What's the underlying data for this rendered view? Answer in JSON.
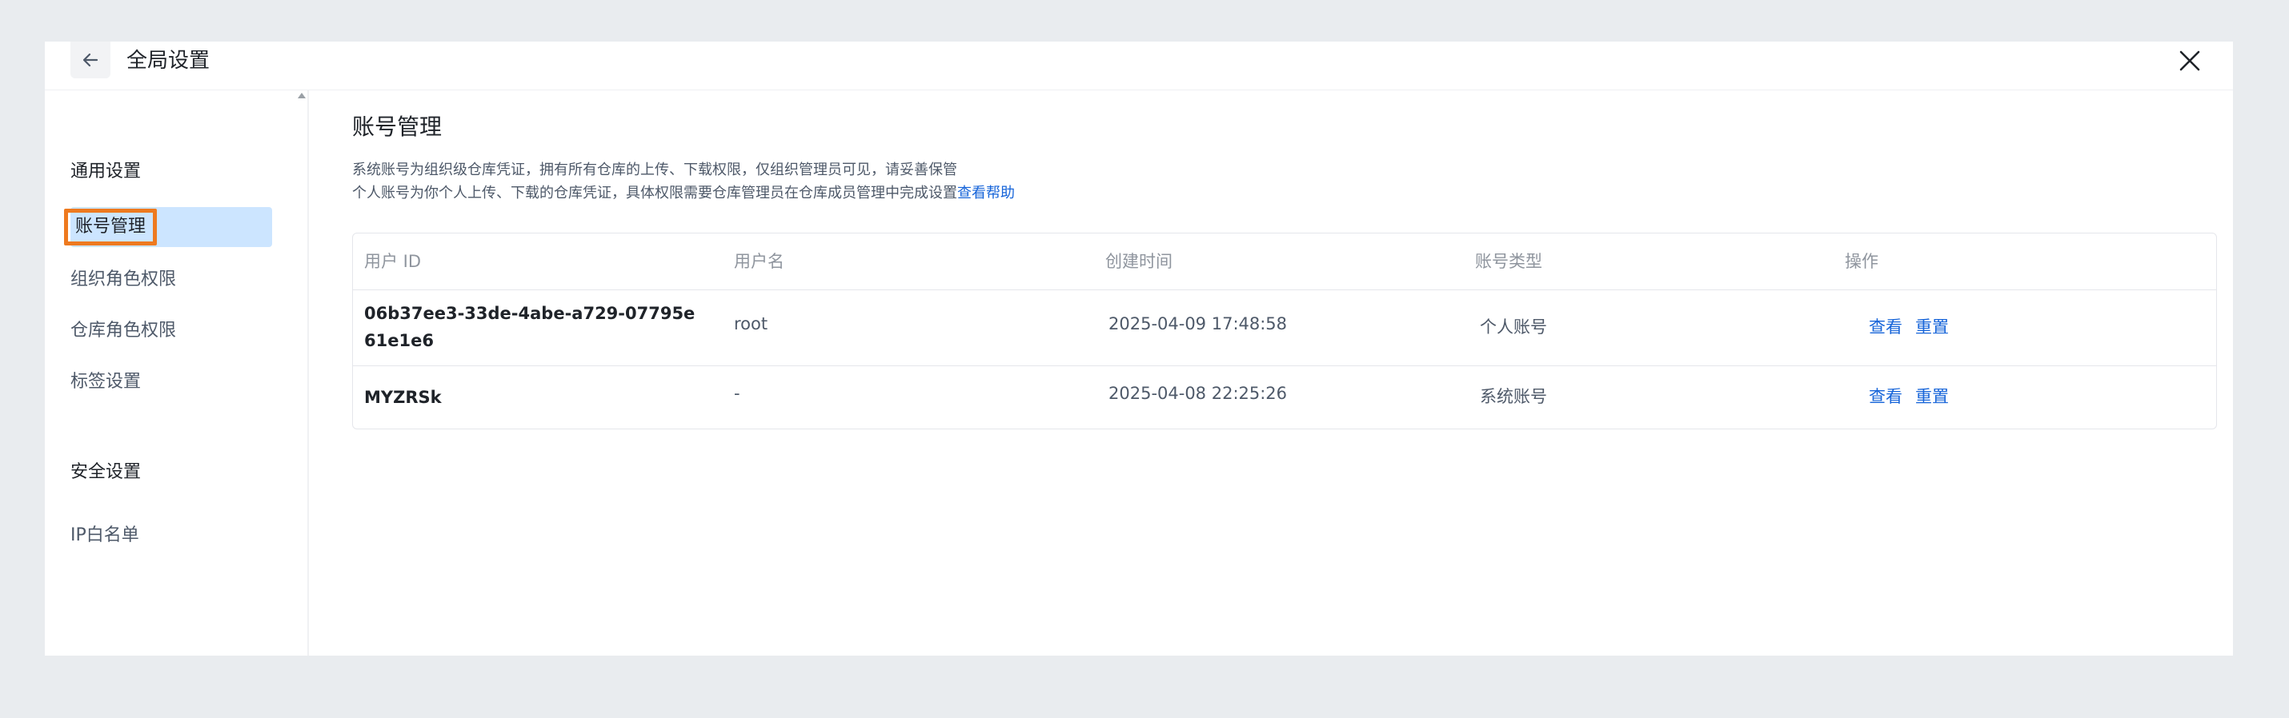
{
  "dialog": {
    "title": "全局设置"
  },
  "sidebar": {
    "groups": [
      {
        "label": "通用设置",
        "items": [
          {
            "label": "账号管理",
            "active": true
          },
          {
            "label": "组织角色权限",
            "active": false
          },
          {
            "label": "仓库角色权限",
            "active": false
          },
          {
            "label": "标签设置",
            "active": false
          }
        ]
      },
      {
        "label": "安全设置",
        "items": [
          {
            "label": "IP白名单",
            "active": false
          }
        ]
      }
    ]
  },
  "main": {
    "title": "账号管理",
    "desc_line1": "系统账号为组织级仓库凭证，拥有所有仓库的上传、下载权限，仅组织管理员可见，请妥善保管",
    "desc_line2": "个人账号为你个人上传、下载的仓库凭证，具体权限需要仓库管理员在仓库成员管理中完成设置",
    "help_link": "查看帮助"
  },
  "table": {
    "headers": [
      "用户 ID",
      "用户名",
      "创建时间",
      "账号类型",
      "操作"
    ],
    "rows": [
      {
        "id": "06b37ee3-33de-4abe-a729-07795e61e1e6",
        "username": "root",
        "created": "2025-04-09 17:48:58",
        "type": "个人账号",
        "view": "查看",
        "reset": "重置"
      },
      {
        "id": "MYZRSk",
        "username": "-",
        "created": "2025-04-08 22:25:26",
        "type": "系统账号",
        "view": "查看",
        "reset": "重置"
      }
    ]
  },
  "icons": {
    "back": "arrow-left-icon",
    "close": "close-icon",
    "scroll_up": "caret-up-icon"
  },
  "colors": {
    "accent": "#1664d9",
    "active_bg": "#cce5ff",
    "highlight": "#ee7a1f"
  }
}
